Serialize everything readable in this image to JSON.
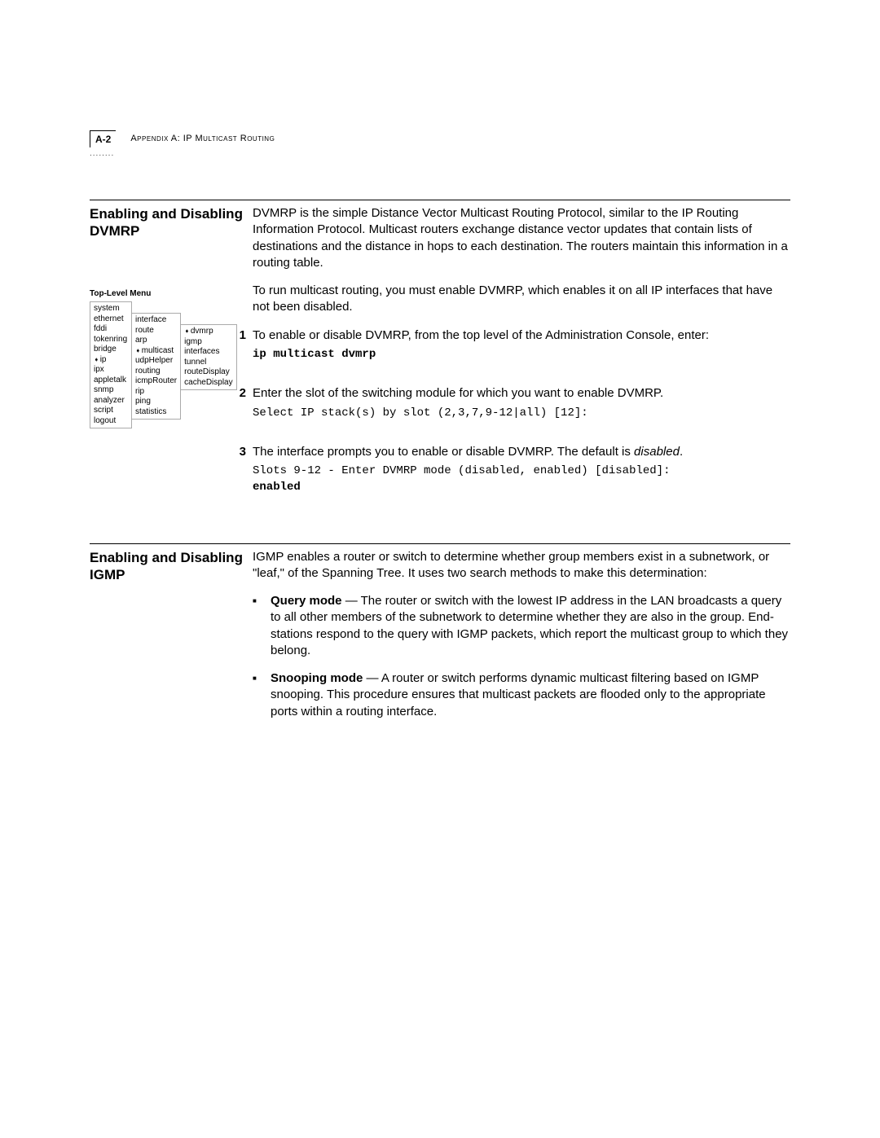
{
  "header": {
    "page_num": "A-2",
    "appendix": "Appendix A: IP Multicast Routing",
    "dots": "........"
  },
  "section1": {
    "title": "Enabling and Disabling DVMRP",
    "p1": "DVMRP is the simple Distance Vector Multicast Routing Protocol, similar to the IP Routing Information Protocol. Multicast routers exchange distance vector updates that contain lists of destinations and the distance in hops to each destination. The routers maintain this information in a routing table.",
    "p2": "To run multicast routing, you must enable DVMRP, which enables it on all IP interfaces that have not been disabled.",
    "step1": "To enable or disable DVMRP, from the top level of the Administration Console, enter:",
    "cmd1": "ip multicast dvmrp",
    "step2": "Enter the slot of the switching module for which you want to enable DVMRP.",
    "cmd2": "Select IP stack(s) by slot (2,3,7,9-12|all) [12]:",
    "step3a": "The interface prompts you to enable or disable DVMRP. The default is ",
    "step3b": "disabled",
    "step3c": ".",
    "cmd3a": "Slots 9-12 - Enter DVMRP mode (disabled, enabled) [disabled]: ",
    "cmd3b": "enabled"
  },
  "menu": {
    "title": "Top-Level Menu",
    "col1": [
      "system",
      "ethernet",
      "fddi",
      "tokenring",
      "bridge",
      "ip",
      "ipx",
      "appletalk",
      "snmp",
      "analyzer",
      "script",
      "logout"
    ],
    "col1_arrow_idx": 5,
    "col2": [
      "interface",
      "route",
      "arp",
      "multicast",
      "udpHelper",
      "routing",
      "icmpRouter",
      "rip",
      "ping",
      "statistics"
    ],
    "col2_arrow_idx": 3,
    "col3": [
      "dvmrp",
      "igmp",
      "interfaces",
      "tunnel",
      "routeDisplay",
      "cacheDisplay"
    ],
    "col3_arrow_idx": 0
  },
  "section2": {
    "title": "Enabling and Disabling IGMP",
    "p1": "IGMP enables a router or switch to determine whether group members exist in a subnetwork, or \"leaf,\" of the Spanning Tree. It uses two search methods to make this determination:",
    "b1_label": "Query mode",
    "b1_text": " — The router or switch with the lowest IP address in the LAN broadcasts a query to all other members of the subnetwork to determine whether they are also in the group. End-stations respond to the query with IGMP packets, which report the multicast group to which they belong.",
    "b2_label": "Snooping mode",
    "b2_text": " — A router or switch performs dynamic multicast filtering based on IGMP snooping. This procedure ensures that multicast packets are flooded only to the appropriate ports within a routing interface."
  }
}
